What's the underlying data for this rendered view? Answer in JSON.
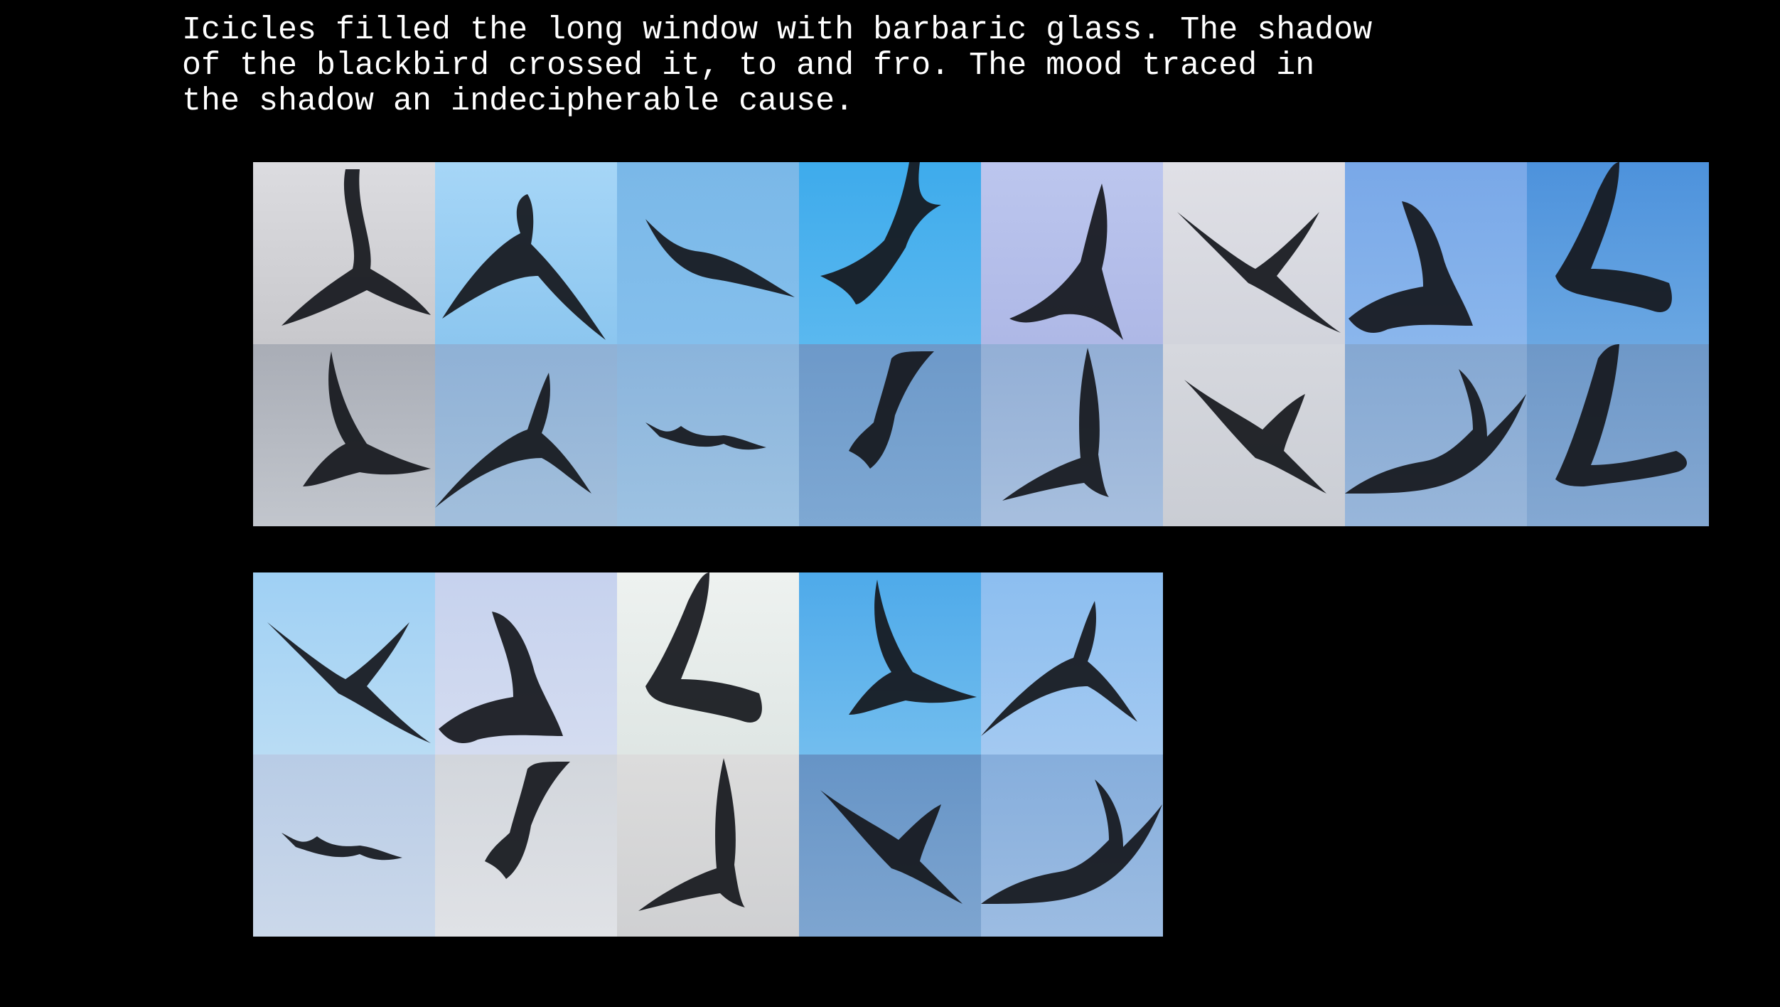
{
  "caption": "Icicles filled the long window with barbaric glass. The shadow\nof the blackbird crossed it, to and fro. The mood traced in\nthe shadow an indecipherable cause.",
  "bird_color": "#15171c",
  "grid_top": {
    "tiles": [
      {
        "icon": "bird-image",
        "sky_top": "#dcdce0",
        "sky_bottom": "#c8c8cc"
      },
      {
        "icon": "bird-image",
        "sky_top": "#a6d6f7",
        "sky_bottom": "#8cc6ef"
      },
      {
        "icon": "bird-image",
        "sky_top": "#7ab8e8",
        "sky_bottom": "#84bfec"
      },
      {
        "icon": "bird-image",
        "sky_top": "#3eabec",
        "sky_bottom": "#5ab8ef"
      },
      {
        "icon": "bird-image",
        "sky_top": "#bcc6ee",
        "sky_bottom": "#aeb8e6"
      },
      {
        "icon": "bird-image",
        "sky_top": "#e0e0e6",
        "sky_bottom": "#d2d4dc"
      },
      {
        "icon": "bird-image",
        "sky_top": "#79a8e8",
        "sky_bottom": "#8ab6ec"
      },
      {
        "icon": "bird-image",
        "sky_top": "#4d92dc",
        "sky_bottom": "#6aa7e2"
      },
      {
        "icon": "bird-image",
        "sky_top": "#a9adb6",
        "sky_bottom": "#c2c6cd"
      },
      {
        "icon": "bird-image",
        "sky_top": "#8fb1d6",
        "sky_bottom": "#a2bfdc"
      },
      {
        "icon": "bird-image",
        "sky_top": "#8ab4dc",
        "sky_bottom": "#9dc2e2"
      },
      {
        "icon": "bird-image",
        "sky_top": "#6d99c9",
        "sky_bottom": "#7ea8d3"
      },
      {
        "icon": "bird-image",
        "sky_top": "#93afd6",
        "sky_bottom": "#a7bfde"
      },
      {
        "icon": "bird-image",
        "sky_top": "#d6d8de",
        "sky_bottom": "#cacdd4"
      },
      {
        "icon": "bird-image",
        "sky_top": "#85a8d2",
        "sky_bottom": "#98b6da"
      },
      {
        "icon": "bird-image",
        "sky_top": "#6e98c8",
        "sky_bottom": "#84a8d2"
      }
    ]
  },
  "grid_bottom": {
    "tiles": [
      {
        "icon": "bird-image",
        "sky_top": "#9fd0f4",
        "sky_bottom": "#b9dcf4"
      },
      {
        "icon": "bird-image",
        "sky_top": "#c6d2ee",
        "sky_bottom": "#d4dcf0"
      },
      {
        "icon": "bird-image",
        "sky_top": "#eef2f0",
        "sky_bottom": "#dfe6e4"
      },
      {
        "icon": "bird-image",
        "sky_top": "#4eaaea",
        "sky_bottom": "#72bdee"
      },
      {
        "icon": "bird-image",
        "sky_top": "#8cbef0",
        "sky_bottom": "#a3c9f1"
      },
      {
        "icon": "bird-image",
        "sky_top": "#b8cce6",
        "sky_bottom": "#cbd8ea"
      },
      {
        "icon": "bird-image",
        "sky_top": "#d2d6dc",
        "sky_bottom": "#e0e2e6"
      },
      {
        "icon": "bird-image",
        "sky_top": "#dcdcdc",
        "sky_bottom": "#cfd0d2"
      },
      {
        "icon": "bird-image",
        "sky_top": "#6694c6",
        "sky_bottom": "#7ea5d0"
      },
      {
        "icon": "bird-image",
        "sky_top": "#86aedc",
        "sky_bottom": "#9cbce2"
      }
    ]
  }
}
